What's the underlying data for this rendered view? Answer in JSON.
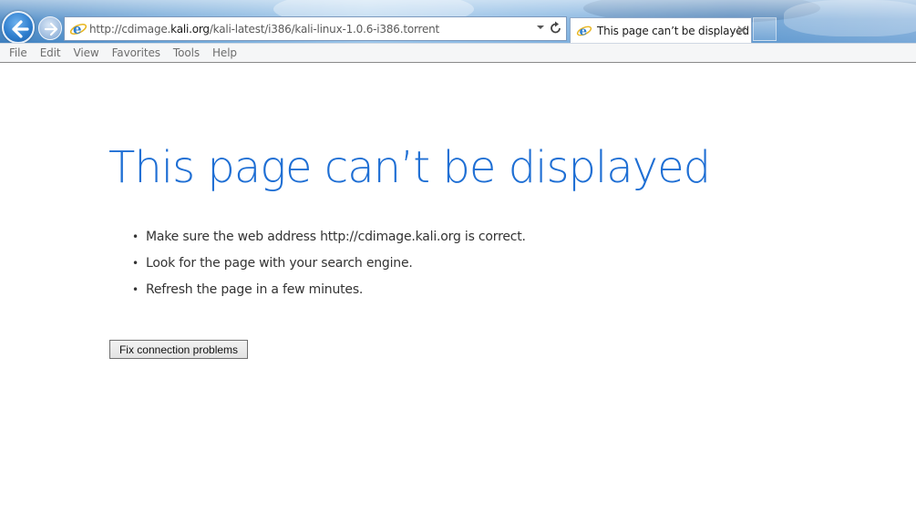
{
  "browser": {
    "address": {
      "url_prefix": "http://cdimage.",
      "url_host": "kali.org",
      "url_suffix": "/kali-latest/i386/kali-linux-1.0.6-i386.torrent"
    },
    "tabs": [
      {
        "title": "This page can’t be displayed",
        "icon": "ie-icon",
        "active": true
      }
    ],
    "icons": {
      "back": "back-arrow-icon",
      "forward": "forward-arrow-icon",
      "refresh": "refresh-icon",
      "dropdown": "chevron-down-icon",
      "close": "close-icon"
    }
  },
  "menu": {
    "items": [
      "File",
      "Edit",
      "View",
      "Favorites",
      "Tools",
      "Help"
    ]
  },
  "page": {
    "title": "This page can’t be displayed",
    "suggestions": [
      "Make sure the web address http://cdimage.kali.org is correct.",
      "Look for the page with your search engine.",
      "Refresh the page in a few minutes."
    ],
    "fix_button_label": "Fix connection problems"
  },
  "colors": {
    "title_blue": "#1f6fd4",
    "text": "#333333",
    "menu_text": "#6d6d6d",
    "ie_blue": "#2f7fcf"
  }
}
